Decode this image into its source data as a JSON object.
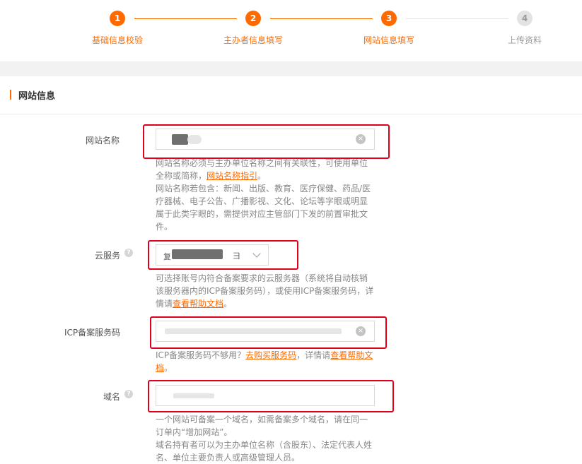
{
  "stepper": {
    "steps": [
      {
        "num": "1",
        "label": "基础信息校验",
        "state": "done"
      },
      {
        "num": "2",
        "label": "主办者信息填写",
        "state": "done"
      },
      {
        "num": "3",
        "label": "网站信息填写",
        "state": "active"
      },
      {
        "num": "4",
        "label": "上传资料",
        "state": "pending"
      }
    ],
    "active_color": "#ff6a00",
    "pending_color": "#dddddd"
  },
  "section": {
    "title": "网站信息"
  },
  "form": {
    "site_name": {
      "label": "网站名称",
      "value": "",
      "hint_before_link": "网站名称必须与主办单位名称之间有关联性，可使用单位全称或简称，",
      "hint_link": "网站名称指引",
      "hint_after_link": "。",
      "hint_2": "网站名称若包含：新闻、出版、教育、医疗保健、药品/医疗器械、电子公告、广播影视、文化、论坛等字眼或明显属于此类字眼的，需提供对应主管部门下发的前置审批文件。"
    },
    "cloud_service": {
      "label": "云服务",
      "value_prefix": "复",
      "value_suffix": "彐",
      "hint_before_link": "可选择账号内符合备案要求的云服务器（系统将自动核销该服务器内的ICP备案服务码），或使用ICP备案服务码，详情请",
      "hint_link": "查看帮助文档",
      "hint_after_link": "。"
    },
    "icp_code": {
      "label": "ICP备案服务码",
      "value": "",
      "hint_before_link": "ICP备案服务码不够用？",
      "hint_link_1": "去购买服务码",
      "hint_middle": "，详情请",
      "hint_link_2": "查看帮助文档",
      "hint_after_link": "。"
    },
    "domain": {
      "label": "域名",
      "value": "",
      "hint_1": "一个网站可备案一个域名，如需备案多个域名，请在同一订单内“增加网站”。",
      "hint_2": "域名持有者可以为主办单位名称（含股东）、法定代表人姓名、单位主要负责人或高级管理人员。"
    }
  },
  "colors": {
    "accent": "#ff6a00",
    "annotation": "#e0001b"
  }
}
